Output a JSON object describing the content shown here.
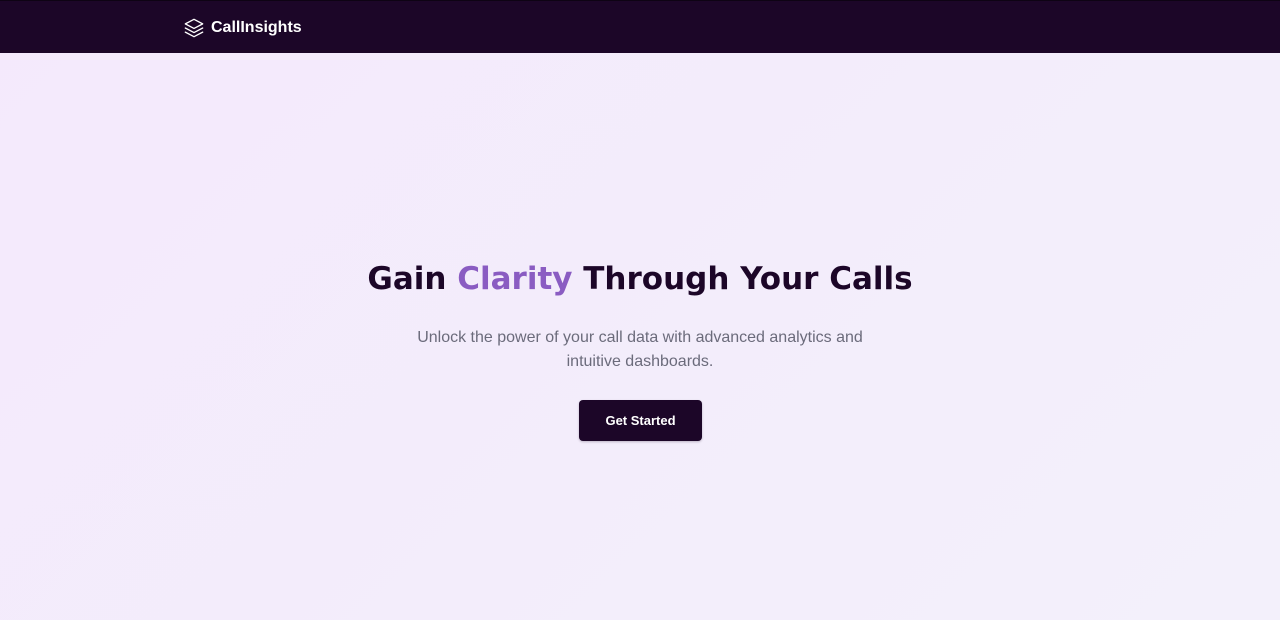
{
  "navbar": {
    "brand_name": "CallInsights",
    "brand_icon": "layers-icon"
  },
  "hero": {
    "title_before": "Gain ",
    "title_accent": "Clarity",
    "title_after": " Through Your Calls",
    "subtitle": "Unlock the power of your call data with advanced analytics and intuitive dashboards.",
    "cta_label": "Get Started"
  },
  "colors": {
    "navbar_bg": "#1c0628",
    "accent": "#8a5cc2",
    "title_text": "#1c0628",
    "subtitle_text": "#6b6b7b",
    "button_bg": "#1c0628",
    "button_text": "#ffffff",
    "page_bg": "#f4ecfc"
  }
}
